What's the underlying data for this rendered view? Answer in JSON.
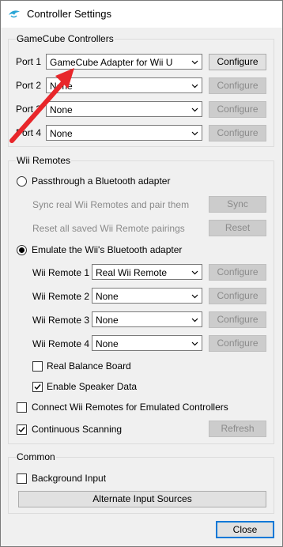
{
  "window": {
    "title": "Controller Settings",
    "icon": "dolphin-icon"
  },
  "gamecube": {
    "title": "GameCube Controllers",
    "ports": [
      {
        "label": "Port 1",
        "value": "GameCube Adapter for Wii U",
        "button": "Configure",
        "button_enabled": true
      },
      {
        "label": "Port 2",
        "value": "None",
        "button": "Configure",
        "button_enabled": false
      },
      {
        "label": "Port 3",
        "value": "None",
        "button": "Configure",
        "button_enabled": false
      },
      {
        "label": "Port 4",
        "value": "None",
        "button": "Configure",
        "button_enabled": false
      }
    ],
    "port_label_occluded_2": "Port 2",
    "port_label_occluded_3": "Port 3"
  },
  "wii": {
    "title": "Wii Remotes",
    "passthrough": {
      "label": "Passthrough a Bluetooth adapter",
      "selected": false,
      "sync_text": "Sync real Wii Remotes and pair them",
      "sync_button": "Sync",
      "reset_text": "Reset all saved Wii Remote pairings",
      "reset_button": "Reset"
    },
    "emulate": {
      "label": "Emulate the Wii's Bluetooth adapter",
      "selected": true
    },
    "remotes": [
      {
        "label": "Wii Remote 1",
        "value": "Real Wii Remote",
        "button": "Configure"
      },
      {
        "label": "Wii Remote 2",
        "value": "None",
        "button": "Configure"
      },
      {
        "label": "Wii Remote 3",
        "value": "None",
        "button": "Configure"
      },
      {
        "label": "Wii Remote 4",
        "value": "None",
        "button": "Configure"
      }
    ],
    "balance_board": {
      "label": "Real Balance Board",
      "checked": false
    },
    "speaker_data": {
      "label": "Enable Speaker Data",
      "checked": true
    },
    "connect_emulated": {
      "label": "Connect Wii Remotes for Emulated Controllers",
      "checked": false
    },
    "continuous_scanning": {
      "label": "Continuous Scanning",
      "checked": true
    },
    "refresh_button": "Refresh"
  },
  "common": {
    "title": "Common",
    "background_input": {
      "label": "Background Input",
      "checked": false
    },
    "alternate_button": "Alternate Input Sources"
  },
  "footer": {
    "close_button": "Close"
  },
  "colors": {
    "accent": "#0078d7",
    "annotation_arrow": "#e8262a",
    "window_bg": "#f0f0f0"
  }
}
